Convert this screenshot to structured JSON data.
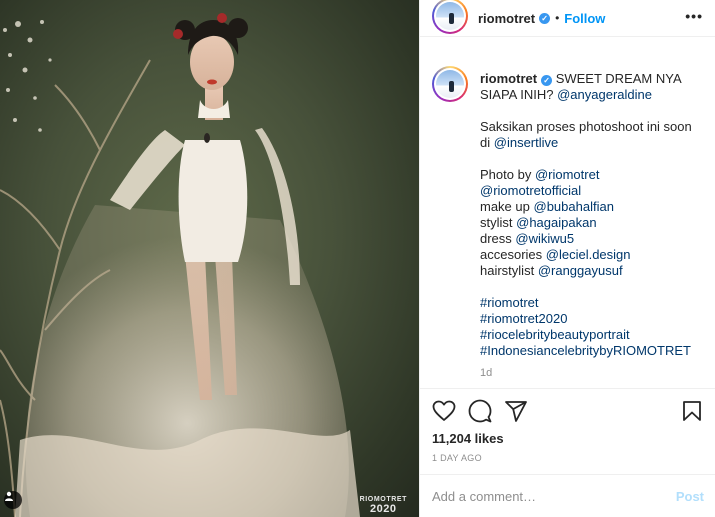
{
  "post": {
    "username": "riomotret",
    "follow_label": "Follow",
    "separator": "•",
    "more_label": "•••",
    "caption": {
      "text1": "SWEET DREAM NYA SIAPA INIH?",
      "mention1": "@anyageraldine",
      "line_saksikan": "Saksikan proses photoshoot ini soon di",
      "mention_insertlive": "@insertlive",
      "credits": [
        {
          "label": "Photo by",
          "handle": "@riomotret"
        },
        {
          "label": "",
          "handle": "@riomotretofficial"
        },
        {
          "label": "make up",
          "handle": "@bubahalfian"
        },
        {
          "label": "stylist",
          "handle": "@hagaipakan"
        },
        {
          "label": "dress",
          "handle": "@wikiwu5"
        },
        {
          "label": "accesories",
          "handle": "@leciel.design"
        },
        {
          "label": "hairstylist",
          "handle": "@ranggayusuf"
        }
      ],
      "hashtags": [
        "#riomotret",
        "#riomotret2020",
        "#riocelebritybeautyportrait",
        "#IndonesiancelebritybyRIOMOTRET"
      ],
      "age": "1d"
    },
    "likes": "11,204 likes",
    "date": "1 DAY AGO",
    "comment_placeholder": "Add a comment…",
    "post_label": "Post"
  },
  "photo": {
    "watermark_line1": "RIOMOTRET",
    "watermark_line2": "2020"
  },
  "colors": {
    "link": "#00376b",
    "follow": "#0095f6",
    "post_disabled": "#b2dffc",
    "verified": "#3897f0"
  },
  "icons": [
    "heart-icon",
    "comment-icon",
    "share-icon",
    "bookmark-icon",
    "verified-icon",
    "more-icon",
    "user-tag-icon"
  ]
}
